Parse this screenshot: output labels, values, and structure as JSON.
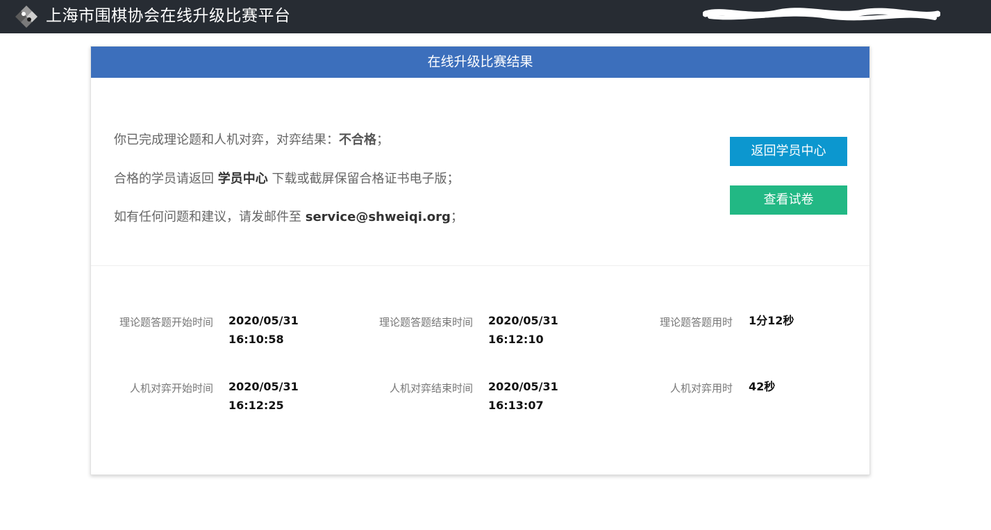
{
  "topbar": {
    "site_title": "上海市围棋协会在线升级比赛平台",
    "logo_icon": "go-stones-logo-icon"
  },
  "card": {
    "header_title": "在线升级比赛结果",
    "message": {
      "line1_prefix": "你已完成理论题和人机对弈，对弈结果：",
      "line1_result": "不合格",
      "line1_suffix": "；",
      "line2_prefix": "合格的学员请返回 ",
      "line2_link": "学员中心",
      "line2_suffix": " 下载或截屏保留合格证书电子版；",
      "line3_prefix": "如有任何问题和建议，请发邮件至 ",
      "line3_email": "service@shweiqi.org",
      "line3_suffix": "；"
    },
    "buttons": {
      "back_label": "返回学员中心",
      "view_paper_label": "查看试卷"
    },
    "stats": {
      "theory_start_label": "理论题答题开始时间",
      "theory_start_date": "2020/05/31",
      "theory_start_time": "16:10:58",
      "theory_end_label": "理论题答题结束时间",
      "theory_end_date": "2020/05/31",
      "theory_end_time": "16:12:10",
      "theory_duration_label": "理论题答题用时",
      "theory_duration": "1分12秒",
      "game_start_label": "人机对弈开始时间",
      "game_start_date": "2020/05/31",
      "game_start_time": "16:12:25",
      "game_end_label": "人机对弈结束时间",
      "game_end_date": "2020/05/31",
      "game_end_time": "16:13:07",
      "game_duration_label": "人机对弈用时",
      "game_duration": "42秒"
    }
  },
  "colors": {
    "topbar_bg": "#272c33",
    "header_bg": "#3c6fbc",
    "back_button": "#0c97cf",
    "view_paper_button": "#22b884"
  }
}
